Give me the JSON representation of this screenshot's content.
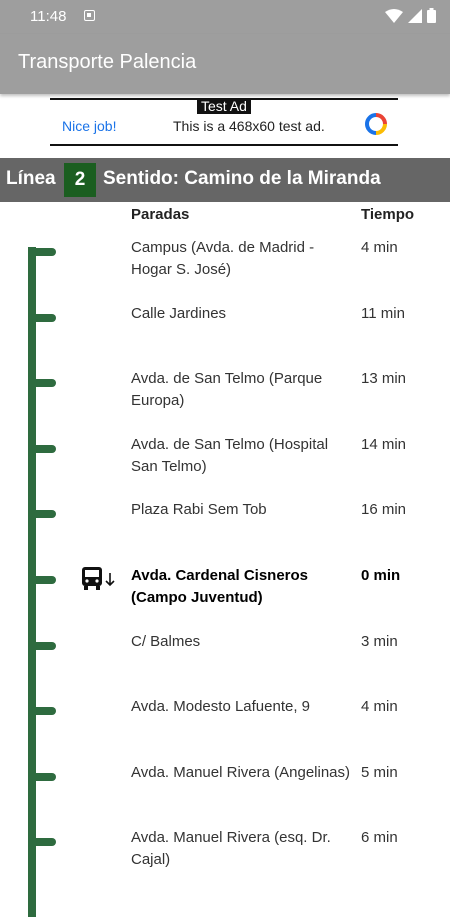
{
  "status_bar": {
    "time": "11:48"
  },
  "app_bar": {
    "title": "Transporte Palencia"
  },
  "ad": {
    "badge": "Test Ad",
    "nice": "Nice job!",
    "message": "This is a 468x60 test ad."
  },
  "line_header": {
    "label": "Línea",
    "number": "2",
    "direction": "Sentido: Camino de la Miranda"
  },
  "table_header": {
    "stops": "Paradas",
    "time": "Tiempo"
  },
  "stops": [
    {
      "name": "Campus (Avda. de Madrid - Hogar S. José)",
      "time": "4 min"
    },
    {
      "name": "Calle Jardines",
      "time": "11 min"
    },
    {
      "name": "Avda. de San Telmo (Parque Europa)",
      "time": "13 min"
    },
    {
      "name": "Avda. de San Telmo (Hospital San Telmo)",
      "time": "14 min"
    },
    {
      "name": "Plaza Rabi Sem Tob",
      "time": "16 min"
    },
    {
      "name": "Avda. Cardenal Cisneros (Campo Juventud)",
      "time": "0 min",
      "current": true
    },
    {
      "name": "C/ Balmes",
      "time": "3 min"
    },
    {
      "name": "Avda. Modesto Lafuente, 9",
      "time": "4 min"
    },
    {
      "name": "Avda. Manuel Rivera (Angelinas)",
      "time": "5 min"
    },
    {
      "name": "Avda. Manuel Rivera (esq. Dr. Cajal)",
      "time": "6 min"
    }
  ],
  "colors": {
    "route": "#2e6b3f",
    "line_badge": "#1b5e20",
    "app_bar": "#9e9e9e"
  }
}
